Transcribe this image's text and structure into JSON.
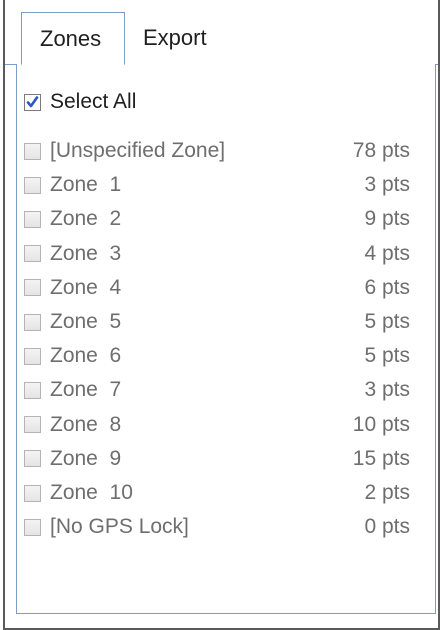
{
  "tabs": [
    {
      "label": "Zones",
      "active": true
    },
    {
      "label": "Export",
      "active": false
    }
  ],
  "select_all": {
    "label": "Select All",
    "checked": true
  },
  "zones": [
    {
      "label": "[Unspecified Zone]",
      "count": "78 pts",
      "checked": false
    },
    {
      "label": "Zone  1",
      "count": "3 pts",
      "checked": false
    },
    {
      "label": "Zone  2",
      "count": "9 pts",
      "checked": false
    },
    {
      "label": "Zone  3",
      "count": "4 pts",
      "checked": false
    },
    {
      "label": "Zone  4",
      "count": "6 pts",
      "checked": false
    },
    {
      "label": "Zone  5",
      "count": "5 pts",
      "checked": false
    },
    {
      "label": "Zone  6",
      "count": "5 pts",
      "checked": false
    },
    {
      "label": "Zone  7",
      "count": "3 pts",
      "checked": false
    },
    {
      "label": "Zone  8",
      "count": "10 pts",
      "checked": false
    },
    {
      "label": "Zone  9",
      "count": "15 pts",
      "checked": false
    },
    {
      "label": "Zone  10",
      "count": "2 pts",
      "checked": false
    },
    {
      "label": "[No GPS Lock]",
      "count": "0 pts",
      "checked": false
    }
  ],
  "colors": {
    "accent_border": "#7a9cc6",
    "checkmark": "#2d56c7",
    "disabled_text": "#6e6e6e"
  },
  "icons": {
    "select_all_check": "checkmark-icon"
  }
}
